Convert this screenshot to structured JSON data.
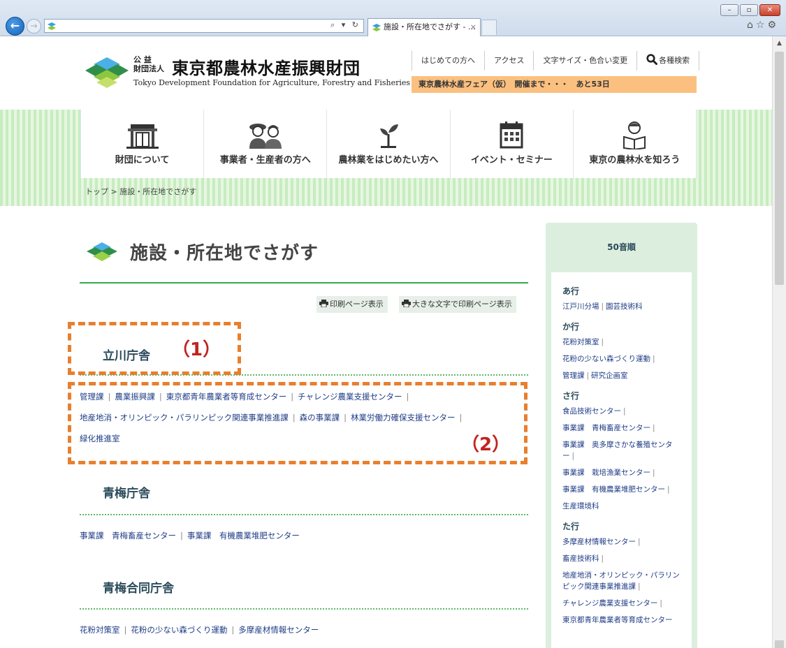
{
  "browser": {
    "tab_title": "施設・所在地でさがす - ...",
    "tab_close": "×",
    "addr_tools": "⌕ ▾ ↻",
    "window_minimize": "–",
    "window_restore": "▫",
    "window_close": "✕",
    "back": "←",
    "forward": "→"
  },
  "header": {
    "hojin_top": "公 益",
    "hojin_bottom": "財団法人",
    "org_name": "東京都農林水産振興財団",
    "org_name_en": "Tokyo Development Foundation for Agriculture, Forestry and Fisheries",
    "util_nav": [
      "はじめての方へ",
      "アクセス",
      "文字サイズ・色合い変更",
      "各種検索"
    ],
    "countdown": "東京農林水産フェア（仮）　開催まで・・・　あと53日"
  },
  "main_nav": [
    {
      "label": "財団について",
      "icon": "building-icon"
    },
    {
      "label": "事業者・生産者の方へ",
      "icon": "farmers-icon"
    },
    {
      "label": "農林業をはじめたい方へ",
      "icon": "sprout-icon"
    },
    {
      "label": "イベント・セミナー",
      "icon": "calendar-icon"
    },
    {
      "label": "東京の農林水を知ろう",
      "icon": "reader-icon"
    }
  ],
  "breadcrumb": "トップ > 施設・所在地でさがす",
  "page": {
    "title": "施設・所在地でさがす",
    "print_button": "印刷ページ表示",
    "print_large_button": "大きな文字で印刷ページ表示"
  },
  "callouts": {
    "one": "（1）",
    "two": "（2）"
  },
  "sections": [
    {
      "heading": "立川庁舎",
      "links": [
        "管理課",
        "農業振興課",
        "東京都青年農業者等育成センター",
        "チャレンジ農業支援センター",
        "地産地消・オリンピック・パラリンピック関連事業推進課",
        "森の事業課",
        "林業労働力確保支援センター",
        "緑化推進室"
      ]
    },
    {
      "heading": "青梅庁舎",
      "links": [
        "事業課　青梅畜産センター",
        "事業課　有機農業堆肥センター"
      ]
    },
    {
      "heading": "青梅合同庁舎",
      "links": [
        "花粉対策室",
        "花粉の少ない森づくり運動",
        "多摩産材情報センター"
      ]
    }
  ],
  "sidebar": {
    "title": "50音順",
    "groups": [
      {
        "head": "あ行",
        "rows": [
          [
            "江戸川分場",
            "園芸技術科"
          ]
        ]
      },
      {
        "head": "か行",
        "rows": [
          [
            "花粉対策室",
            ""
          ],
          [
            "花粉の少ない森づくり運動",
            ""
          ],
          [
            "管理課",
            "研究企画室"
          ]
        ]
      },
      {
        "head": "さ行",
        "rows": [
          [
            "食品技術センター",
            ""
          ],
          [
            "事業課　青梅畜産センター",
            ""
          ],
          [
            "事業課　奥多摩さかな養殖センター",
            ""
          ],
          [
            "事業課　栽培漁業センター",
            ""
          ],
          [
            "事業課　有機農業堆肥センター",
            ""
          ],
          [
            "生産環境科"
          ]
        ]
      },
      {
        "head": "た行",
        "rows": [
          [
            "多摩産材情報センター",
            ""
          ],
          [
            "畜産技術科",
            ""
          ],
          [
            "地産地消・オリンピック・パラリンピック関連事業推進課",
            ""
          ],
          [
            "チャレンジ農業支援センター",
            ""
          ],
          [
            "東京都青年農業者等育成センター"
          ]
        ]
      }
    ]
  }
}
